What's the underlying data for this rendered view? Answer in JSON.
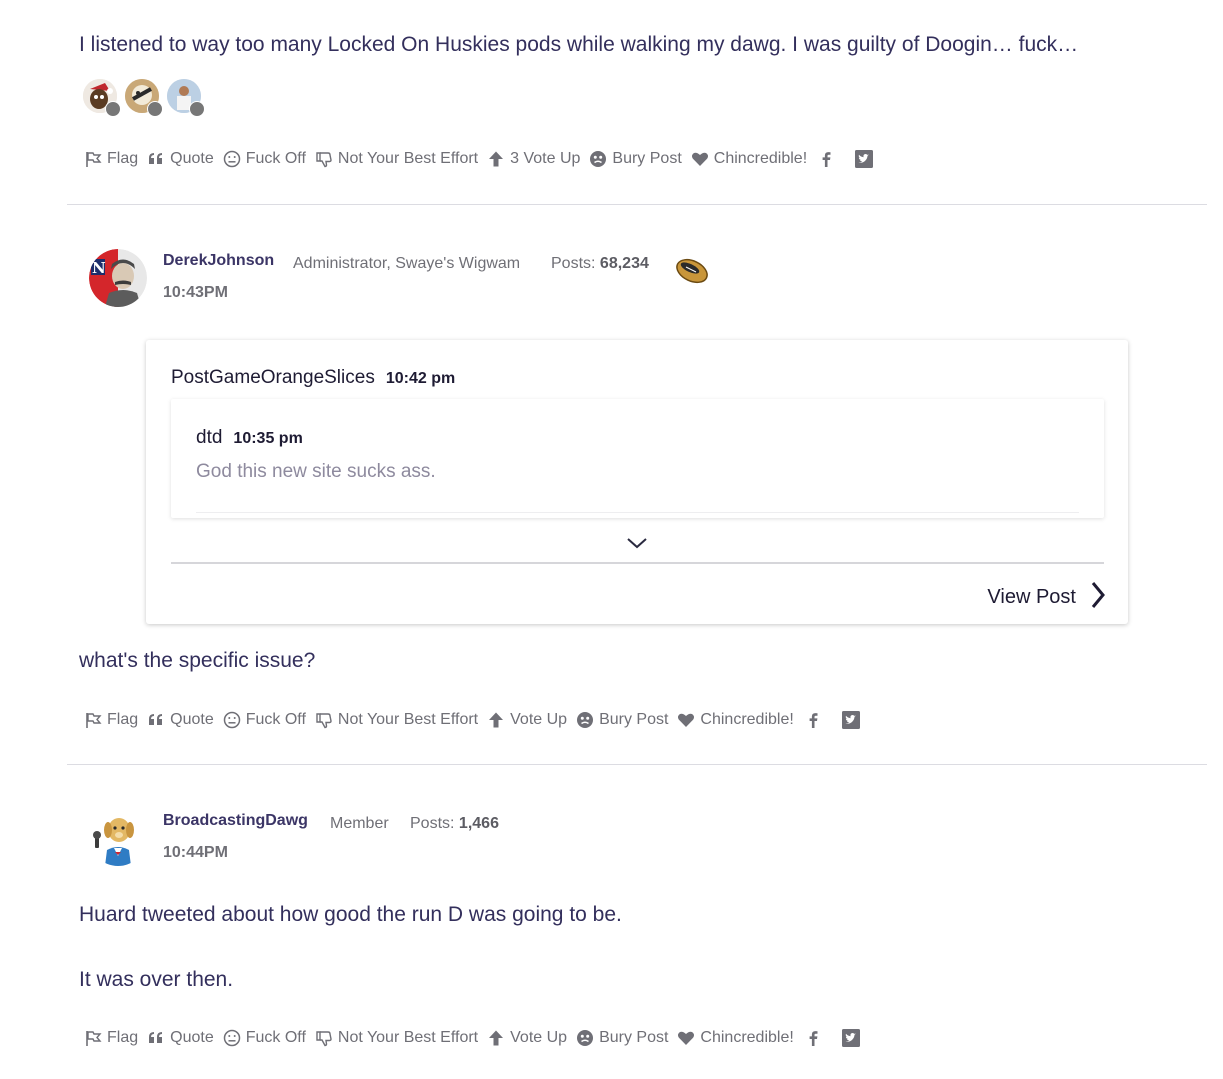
{
  "post1": {
    "text": "I listened to way too many Locked On Huskies pods while walking my dawg. I was guilty of Doogin… fuck…",
    "actions": {
      "flag": "Flag",
      "quote": "Quote",
      "fuck_off": "Fuck Off",
      "not_best": "Not Your Best Effort",
      "vote_up": "3 Vote Up",
      "bury": "Bury Post",
      "chincredible": "Chincredible!"
    }
  },
  "post2": {
    "author": "DerekJohnson",
    "role": "Administrator, Swaye's Wigwam",
    "posts_label": "Posts:",
    "posts_count": "68,234",
    "time": "10:43PM",
    "quote": {
      "author": "PostGameOrangeSlices",
      "time": "10:42 pm",
      "nested_author": "dtd",
      "nested_time": "10:35 pm",
      "nested_text": "God this new site sucks ass.",
      "view_post": "View Post"
    },
    "text": "what's the specific issue?",
    "actions": {
      "flag": "Flag",
      "quote": "Quote",
      "fuck_off": "Fuck Off",
      "not_best": "Not Your Best Effort",
      "vote_up": "Vote Up",
      "bury": "Bury Post",
      "chincredible": "Chincredible!"
    }
  },
  "post3": {
    "author": "BroadcastingDawg",
    "role": "Member",
    "posts_label": "Posts:",
    "posts_count": "1,466",
    "time": "10:44PM",
    "text_line1": "Huard tweeted about how good the run D was going to be.",
    "text_line2": "It was over then.",
    "actions": {
      "flag": "Flag",
      "quote": "Quote",
      "fuck_off": "Fuck Off",
      "not_best": "Not Your Best Effort",
      "vote_up": "Vote Up",
      "bury": "Bury Post",
      "chincredible": "Chincredible!"
    }
  },
  "icons": [
    "flag-icon",
    "quote-icon",
    "fuck-off-icon",
    "thumbs-down-icon",
    "arrow-up-icon",
    "bury-icon",
    "heart-icon",
    "facebook-icon",
    "twitter-icon",
    "chevron-down-icon",
    "chevron-right-icon",
    "football-icon"
  ]
}
